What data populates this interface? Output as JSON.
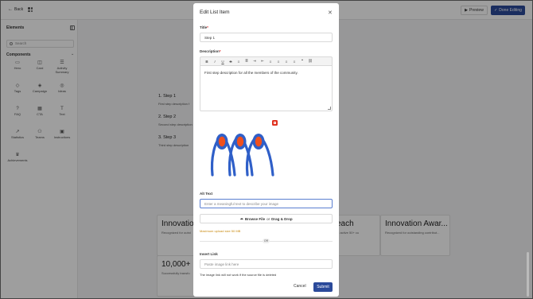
{
  "topbar": {
    "back_label": "Back",
    "preview_label": "Preview",
    "done_label": "Done Editing",
    "accent_color": "#2b4a9a"
  },
  "sidebar": {
    "title": "Elements",
    "search_placeholder": "Search",
    "components_label": "Components",
    "components": [
      {
        "label": "Hero",
        "icon": "hero-icon",
        "glyph": "▭"
      },
      {
        "label": "Card",
        "icon": "card-icon",
        "glyph": "◫"
      },
      {
        "label": "Activity Summary",
        "icon": "activity-icon",
        "glyph": "☰"
      },
      {
        "label": "Tags",
        "icon": "tag-icon",
        "glyph": "◇"
      },
      {
        "label": "Campaign",
        "icon": "campaign-icon",
        "glyph": "◈"
      },
      {
        "label": "Ideas",
        "icon": "idea-icon",
        "glyph": "◎"
      },
      {
        "label": "FAQ",
        "icon": "faq-icon",
        "glyph": "?"
      },
      {
        "label": "CTA",
        "icon": "cta-icon",
        "glyph": "▦"
      },
      {
        "label": "Text",
        "icon": "text-icon",
        "glyph": "T"
      },
      {
        "label": "Statistics",
        "icon": "statistics-icon",
        "glyph": "↗"
      },
      {
        "label": "Teams",
        "icon": "teams-icon",
        "glyph": "⚇"
      },
      {
        "label": "Instructions",
        "icon": "instructions-icon",
        "glyph": "▣"
      },
      {
        "label": "Achievements",
        "icon": "achievement-icon",
        "glyph": "♛"
      }
    ]
  },
  "canvas": {
    "steps": [
      {
        "title": "1. Step 1",
        "desc": "First step description f"
      },
      {
        "title": "2. Step 2",
        "desc": "Second step description"
      },
      {
        "title": "3. Step 3",
        "desc": "Third step description"
      }
    ],
    "cards": [
      {
        "title": "Innovation",
        "desc": "Recognized for outst"
      },
      {
        "title": "each",
        "desc": "to active 50+ cu"
      },
      {
        "title": "Innovation Awar...",
        "desc": "Recognized for outstanding contribut..."
      },
      {
        "title": "10,000+ I",
        "desc": "Successfully transfo"
      }
    ]
  },
  "modal": {
    "title": "Edit List Item",
    "title_label": "Title",
    "title_value": "Step 1",
    "description_label": "Description",
    "description_value": "First step description for all the members of the community.",
    "toolbar_items": [
      {
        "icon": "bold-icon",
        "glyph": "B"
      },
      {
        "icon": "italic-icon",
        "glyph": "I"
      },
      {
        "icon": "underline-icon",
        "glyph": "U"
      },
      {
        "icon": "strikethrough-icon",
        "glyph": "S"
      },
      {
        "icon": "bullet-list-icon",
        "glyph": "≡"
      },
      {
        "icon": "numbered-list-icon",
        "glyph": "≣"
      },
      {
        "icon": "indent-icon",
        "glyph": "⇥"
      },
      {
        "icon": "outdent-icon",
        "glyph": "⇤"
      },
      {
        "icon": "align-left-icon",
        "glyph": "≡"
      },
      {
        "icon": "align-center-icon",
        "glyph": "≡"
      },
      {
        "icon": "align-right-icon",
        "glyph": "≡"
      },
      {
        "icon": "justify-icon",
        "glyph": "≡"
      },
      {
        "icon": "quote-icon",
        "glyph": "❝"
      },
      {
        "icon": "link-icon",
        "glyph": "⛓"
      }
    ],
    "alt_text_label": "Alt Text",
    "alt_text_placeholder": "Enter a meaningful text to describe your image",
    "browse_label": "Browse File",
    "or_drag_label": "or",
    "drag_drop_label": "Drag & Drop",
    "max_size_note": "Maximum upload size 50 MB",
    "or_label": "OR",
    "insert_link_label": "Insert Link",
    "link_placeholder": "Paste image link here",
    "link_note": "The image link will not work if the source file is deleted",
    "cancel_label": "Cancel",
    "submit_label": "Submit",
    "image_colors": {
      "figure": "#2f5fc8",
      "head": "#f0501e",
      "delete": "#e0301e"
    },
    "warning_color": "#c98a10"
  }
}
